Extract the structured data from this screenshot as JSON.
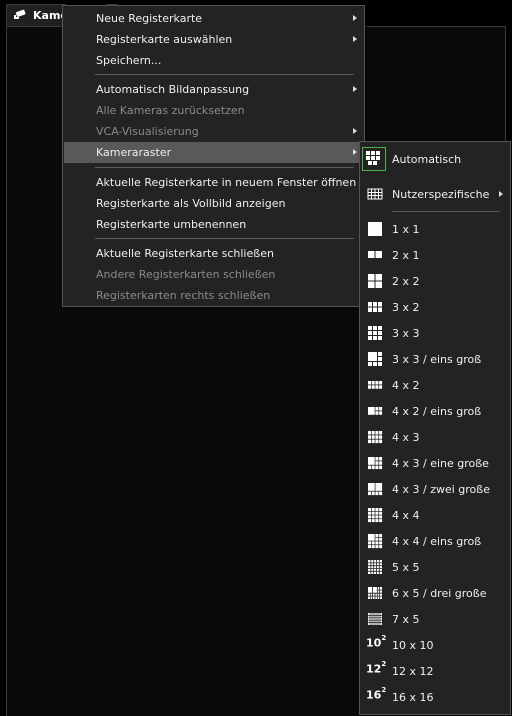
{
  "tab": {
    "label": "Kame"
  },
  "main_menu": {
    "items": [
      {
        "label": "Neue Registerkarte"
      },
      {
        "label": "Registerkarte auswählen"
      },
      {
        "label": "Speichern..."
      },
      {
        "label": "Automatisch Bildanpassung"
      },
      {
        "label": "Alle Kameras zurücksetzen"
      },
      {
        "label": "VCA-Visualisierung"
      },
      {
        "label": "Kameraraster"
      },
      {
        "label": "Aktuelle Registerkarte in neuem Fenster öffnen"
      },
      {
        "label": "Registerkarte als Vollbild anzeigen"
      },
      {
        "label": "Registerkarte umbenennen"
      },
      {
        "label": "Aktuelle Registerkarte schließen"
      },
      {
        "label": "Andere Registerkarten schließen"
      },
      {
        "label": "Registerkarten rechts schließen"
      }
    ]
  },
  "grid_menu": {
    "items": [
      {
        "label": "Automatisch"
      },
      {
        "label": "Nutzerspezifische"
      },
      {
        "label": "1 x 1"
      },
      {
        "label": "2 x 1"
      },
      {
        "label": "2 x 2"
      },
      {
        "label": "3 x 2"
      },
      {
        "label": "3 x 3"
      },
      {
        "label": "3 x 3 / eins groß"
      },
      {
        "label": "4 x 2"
      },
      {
        "label": "4 x 2 / eins groß"
      },
      {
        "label": "4 x 3"
      },
      {
        "label": "4 x 3 / eine große"
      },
      {
        "label": "4 x 3 / zwei große"
      },
      {
        "label": "4 x 4"
      },
      {
        "label": "4 x 4 / eins groß"
      },
      {
        "label": "5 x 5"
      },
      {
        "label": "6 x 5 / drei große"
      },
      {
        "label": "7 x 5"
      },
      {
        "label": "10 x 10",
        "badge_base": "10",
        "badge_exp": "2"
      },
      {
        "label": "12 x 12",
        "badge_base": "12",
        "badge_exp": "2"
      },
      {
        "label": "16 x 16",
        "badge_base": "16",
        "badge_exp": "2"
      }
    ]
  },
  "colors": {
    "selected_border": "#4caf50",
    "hover_bg": "#595959",
    "disabled_text": "#8a8a8a"
  }
}
